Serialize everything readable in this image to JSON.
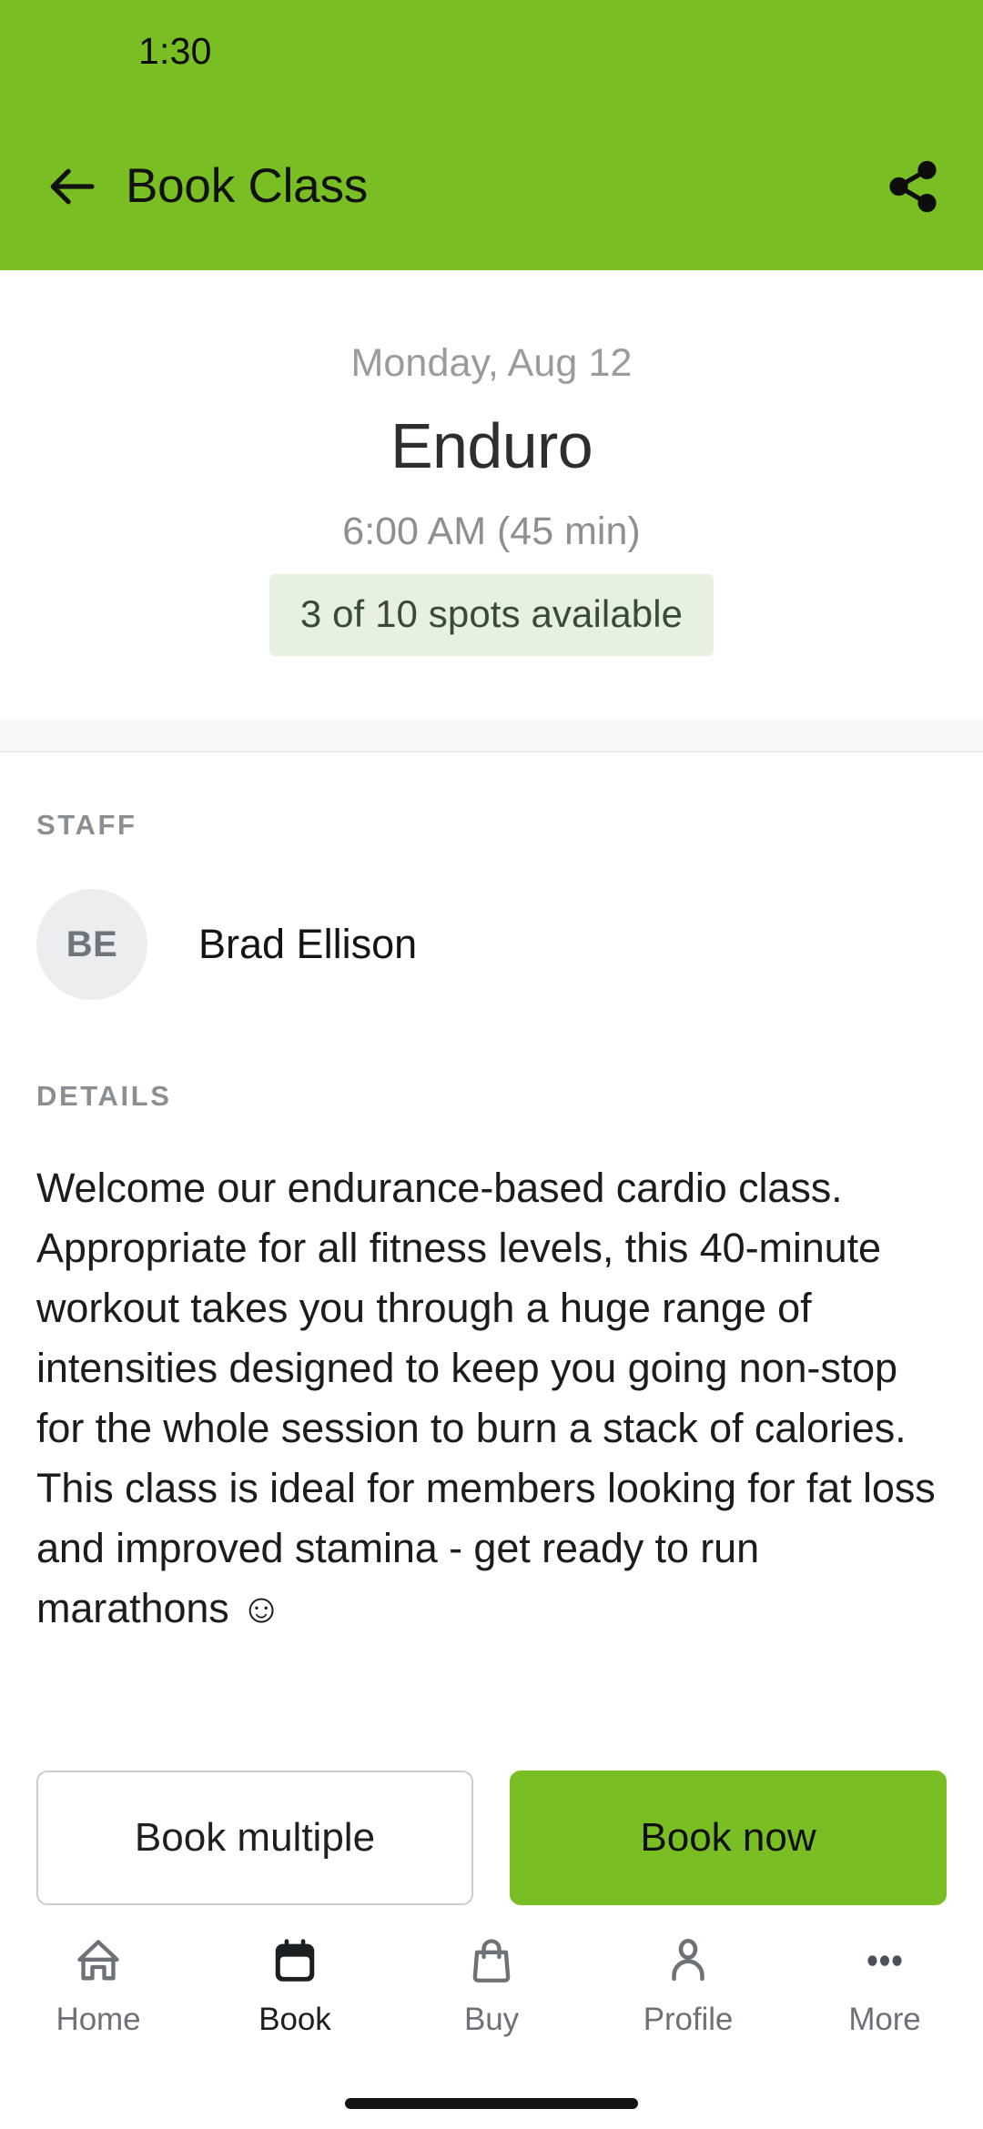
{
  "theme": {
    "brand_green": "#79BE22",
    "badge_bg": "#E7F1E1",
    "badge_text": "#3A4A3A",
    "avatar_bg": "#ECEDEF",
    "muted_text": "#8A8F94"
  },
  "status_bar": {
    "time": "1:30"
  },
  "app_bar": {
    "title": "Book Class",
    "back_icon": "arrow-left-icon",
    "share_icon": "share-icon"
  },
  "class_header": {
    "date": "Monday, Aug 12",
    "name": "Enduro",
    "time": "6:00 AM (45 min)",
    "spots_badge": "3 of 10 spots available"
  },
  "staff_section": {
    "label": "STAFF",
    "members": [
      {
        "initials": "BE",
        "name": "Brad Ellison"
      }
    ]
  },
  "details_section": {
    "label": "DETAILS",
    "text": "Welcome our endurance-based cardio class. Appropriate for all fitness levels, this 40-minute workout takes you through a huge range of intensities designed to keep you going non-stop for the whole session to burn a stack of calories. This class is ideal for members looking for fat loss and improved stamina - get ready to run marathons ☺"
  },
  "actions": {
    "book_multiple_label": "Book multiple",
    "book_now_label": "Book now"
  },
  "bottom_nav": {
    "items": [
      {
        "label": "Home",
        "icon": "home-icon",
        "active": false
      },
      {
        "label": "Book",
        "icon": "calendar-icon",
        "active": true
      },
      {
        "label": "Buy",
        "icon": "shopping-bag-icon",
        "active": false
      },
      {
        "label": "Profile",
        "icon": "person-icon",
        "active": false
      },
      {
        "label": "More",
        "icon": "ellipsis-icon",
        "active": false
      }
    ]
  }
}
